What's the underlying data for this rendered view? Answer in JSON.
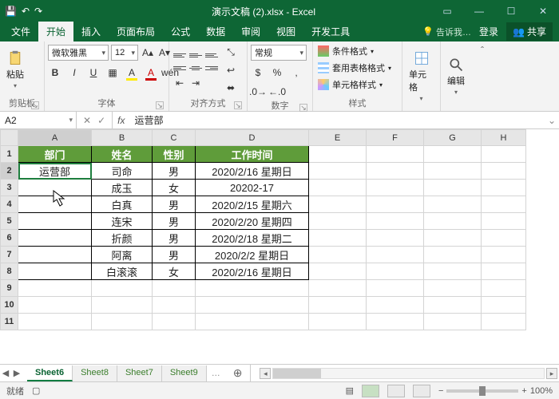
{
  "titlebar": {
    "title": "演示文稿 (2).xlsx - Excel"
  },
  "tabs": {
    "file": "文件",
    "items": [
      "开始",
      "插入",
      "页面布局",
      "公式",
      "数据",
      "审阅",
      "视图",
      "开发工具"
    ],
    "active": "开始",
    "tellme": "告诉我…",
    "signin": "登录",
    "share": "共享"
  },
  "ribbon": {
    "clipboard": {
      "paste": "粘贴",
      "group": "剪贴板"
    },
    "font": {
      "name": "微软雅黑",
      "size": "12",
      "group": "字体"
    },
    "align": {
      "group": "对齐方式"
    },
    "number": {
      "format": "常规",
      "group": "数字"
    },
    "styles": {
      "cond": "条件格式",
      "tablefmt": "套用表格格式",
      "cellstyle": "单元格样式",
      "group": "样式"
    },
    "cells": {
      "label": "单元格"
    },
    "editing": {
      "label": "编辑"
    }
  },
  "namebar": {
    "ref": "A2",
    "formula": "运营部"
  },
  "grid": {
    "cols": [
      "A",
      "B",
      "C",
      "D",
      "E",
      "F",
      "G",
      "H"
    ],
    "widths": [
      92,
      76,
      54,
      142,
      72,
      72,
      72,
      56
    ],
    "headerRow": [
      "部门",
      "姓名",
      "性别",
      "工作时间"
    ],
    "rows": [
      [
        "运营部",
        "司命",
        "男",
        "2020/2/16 星期日"
      ],
      [
        "",
        "成玉",
        "女",
        "20202-17"
      ],
      [
        "",
        "白真",
        "男",
        "2020/2/15 星期六"
      ],
      [
        "",
        "连宋",
        "男",
        "2020/2/20 星期四"
      ],
      [
        "",
        "折颜",
        "男",
        "2020/2/18 星期二"
      ],
      [
        "",
        "阿离",
        "男",
        "2020/2/2 星期日"
      ],
      [
        "",
        "白滚滚",
        "女",
        "2020/2/16 星期日"
      ]
    ],
    "visibleRows": 11,
    "selected": "A2"
  },
  "sheets": {
    "tabs": [
      "Sheet6",
      "Sheet8",
      "Sheet7",
      "Sheet9"
    ],
    "active": "Sheet6"
  },
  "status": {
    "ready": "就绪",
    "zoom": "100%"
  }
}
